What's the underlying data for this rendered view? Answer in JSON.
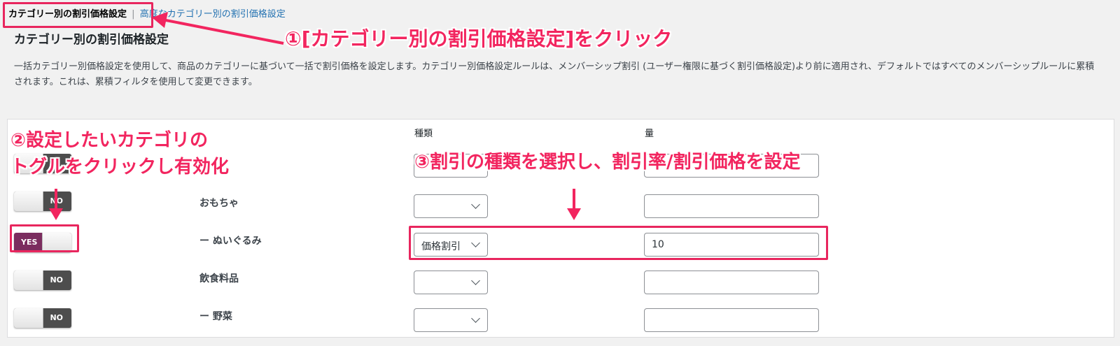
{
  "subnav": {
    "current": "カテゴリー別の割引価格設定",
    "separator": "|",
    "advanced_link": "高度なカテゴリー別の割引価格設定"
  },
  "page": {
    "title": "カテゴリー別の割引価格設定",
    "description": "一括カテゴリー別価格設定を使用して、商品のカテゴリーに基づいて一括で割引価格を設定します。カテゴリー別価格設定ルールは、メンバーシップ割引 (ユーザー権限に基づく割引価格設定)より前に適用され、デフォルトではすべてのメンバーシップルールに累積されます。これは、累積フィルタを使用して変更できます。"
  },
  "table": {
    "headers": {
      "type": "種類",
      "amount": "量"
    },
    "rows": [
      {
        "toggle_label": "",
        "category": "",
        "type": "",
        "amount": ""
      },
      {
        "toggle_label": "NO",
        "category": "おもちゃ",
        "type": "",
        "amount": ""
      },
      {
        "toggle_label": "YES",
        "category": "ー ぬいぐるみ",
        "type": "価格割引",
        "amount": "10"
      },
      {
        "toggle_label": "NO",
        "category": "飲食料品",
        "type": "",
        "amount": ""
      },
      {
        "toggle_label": "NO",
        "category": "ー 野菜",
        "type": "",
        "amount": ""
      }
    ]
  },
  "callouts": {
    "step1": "①[カテゴリー別の割引価格設定]をクリック",
    "step2_line1": "②設定したいカテゴリの",
    "step2_line2": "トグルをクリックし有効化",
    "step3": "③割引の種類を選択し、割引率/割引価格を設定"
  },
  "colors": {
    "accent": "#f2255f",
    "toggle_on": "#7b2d5f",
    "toggle_off": "#4d4d4d",
    "link": "#2271b1"
  }
}
